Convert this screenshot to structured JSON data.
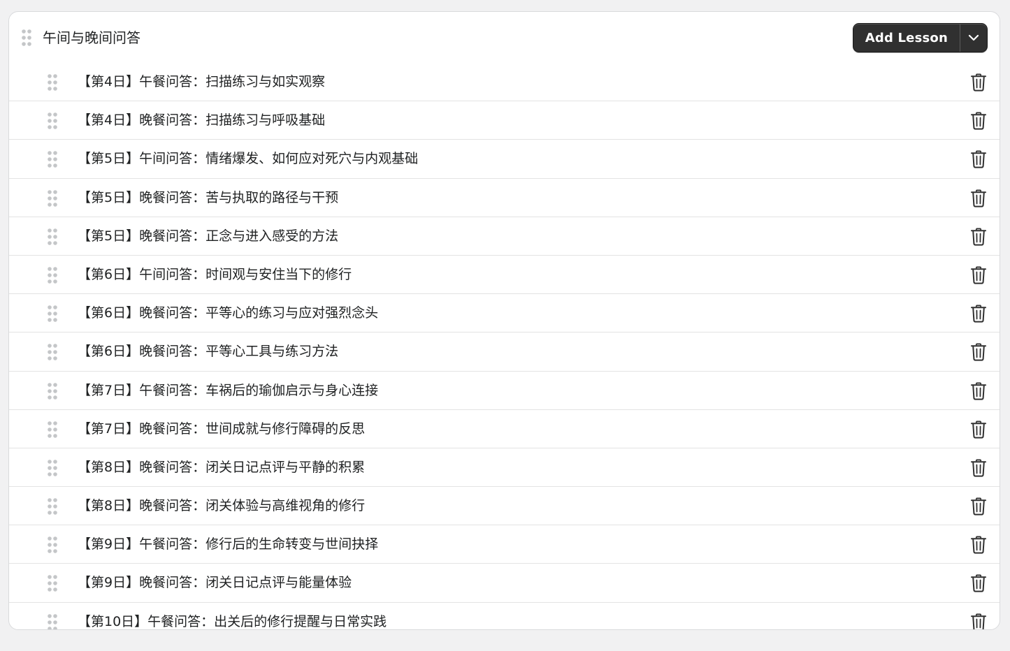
{
  "section": {
    "title": "午间与晚间问答",
    "add_label": "Add Lesson",
    "drag_icon": "drag-handle-icon",
    "dropdown_icon": "chevron-down-icon"
  },
  "lessons": [
    {
      "title": "【第4日】午餐问答：扫描练习与如实观察"
    },
    {
      "title": "【第4日】晚餐问答：扫描练习与呼吸基础"
    },
    {
      "title": "【第5日】午间问答：情绪爆发、如何应对死穴与内观基础"
    },
    {
      "title": "【第5日】晚餐问答：苦与执取的路径与干预"
    },
    {
      "title": "【第5日】晚餐问答：正念与进入感受的方法"
    },
    {
      "title": "【第6日】午间问答：时间观与安住当下的修行"
    },
    {
      "title": "【第6日】晚餐问答：平等心的练习与应对强烈念头"
    },
    {
      "title": "【第6日】晚餐问答：平等心工具与练习方法"
    },
    {
      "title": "【第7日】午餐问答：车祸后的瑜伽启示与身心连接"
    },
    {
      "title": "【第7日】晚餐问答：世间成就与修行障碍的反思"
    },
    {
      "title": "【第8日】晚餐问答：闭关日记点评与平静的积累"
    },
    {
      "title": "【第8日】晚餐问答：闭关体验与高维视角的修行"
    },
    {
      "title": "【第9日】午餐问答：修行后的生命转变与世间抉择"
    },
    {
      "title": "【第9日】晚餐问答：闭关日记点评与能量体验"
    },
    {
      "title": "【第10日】午餐问答：出关后的修行提醒与日常实践"
    }
  ],
  "colors": {
    "button_bg": "#303030",
    "text": "#202223",
    "handle": "#c4c6c8",
    "divider": "#e3e3e3"
  },
  "icons": {
    "row_drag": "drag-handle-icon",
    "row_delete": "trash-icon"
  }
}
